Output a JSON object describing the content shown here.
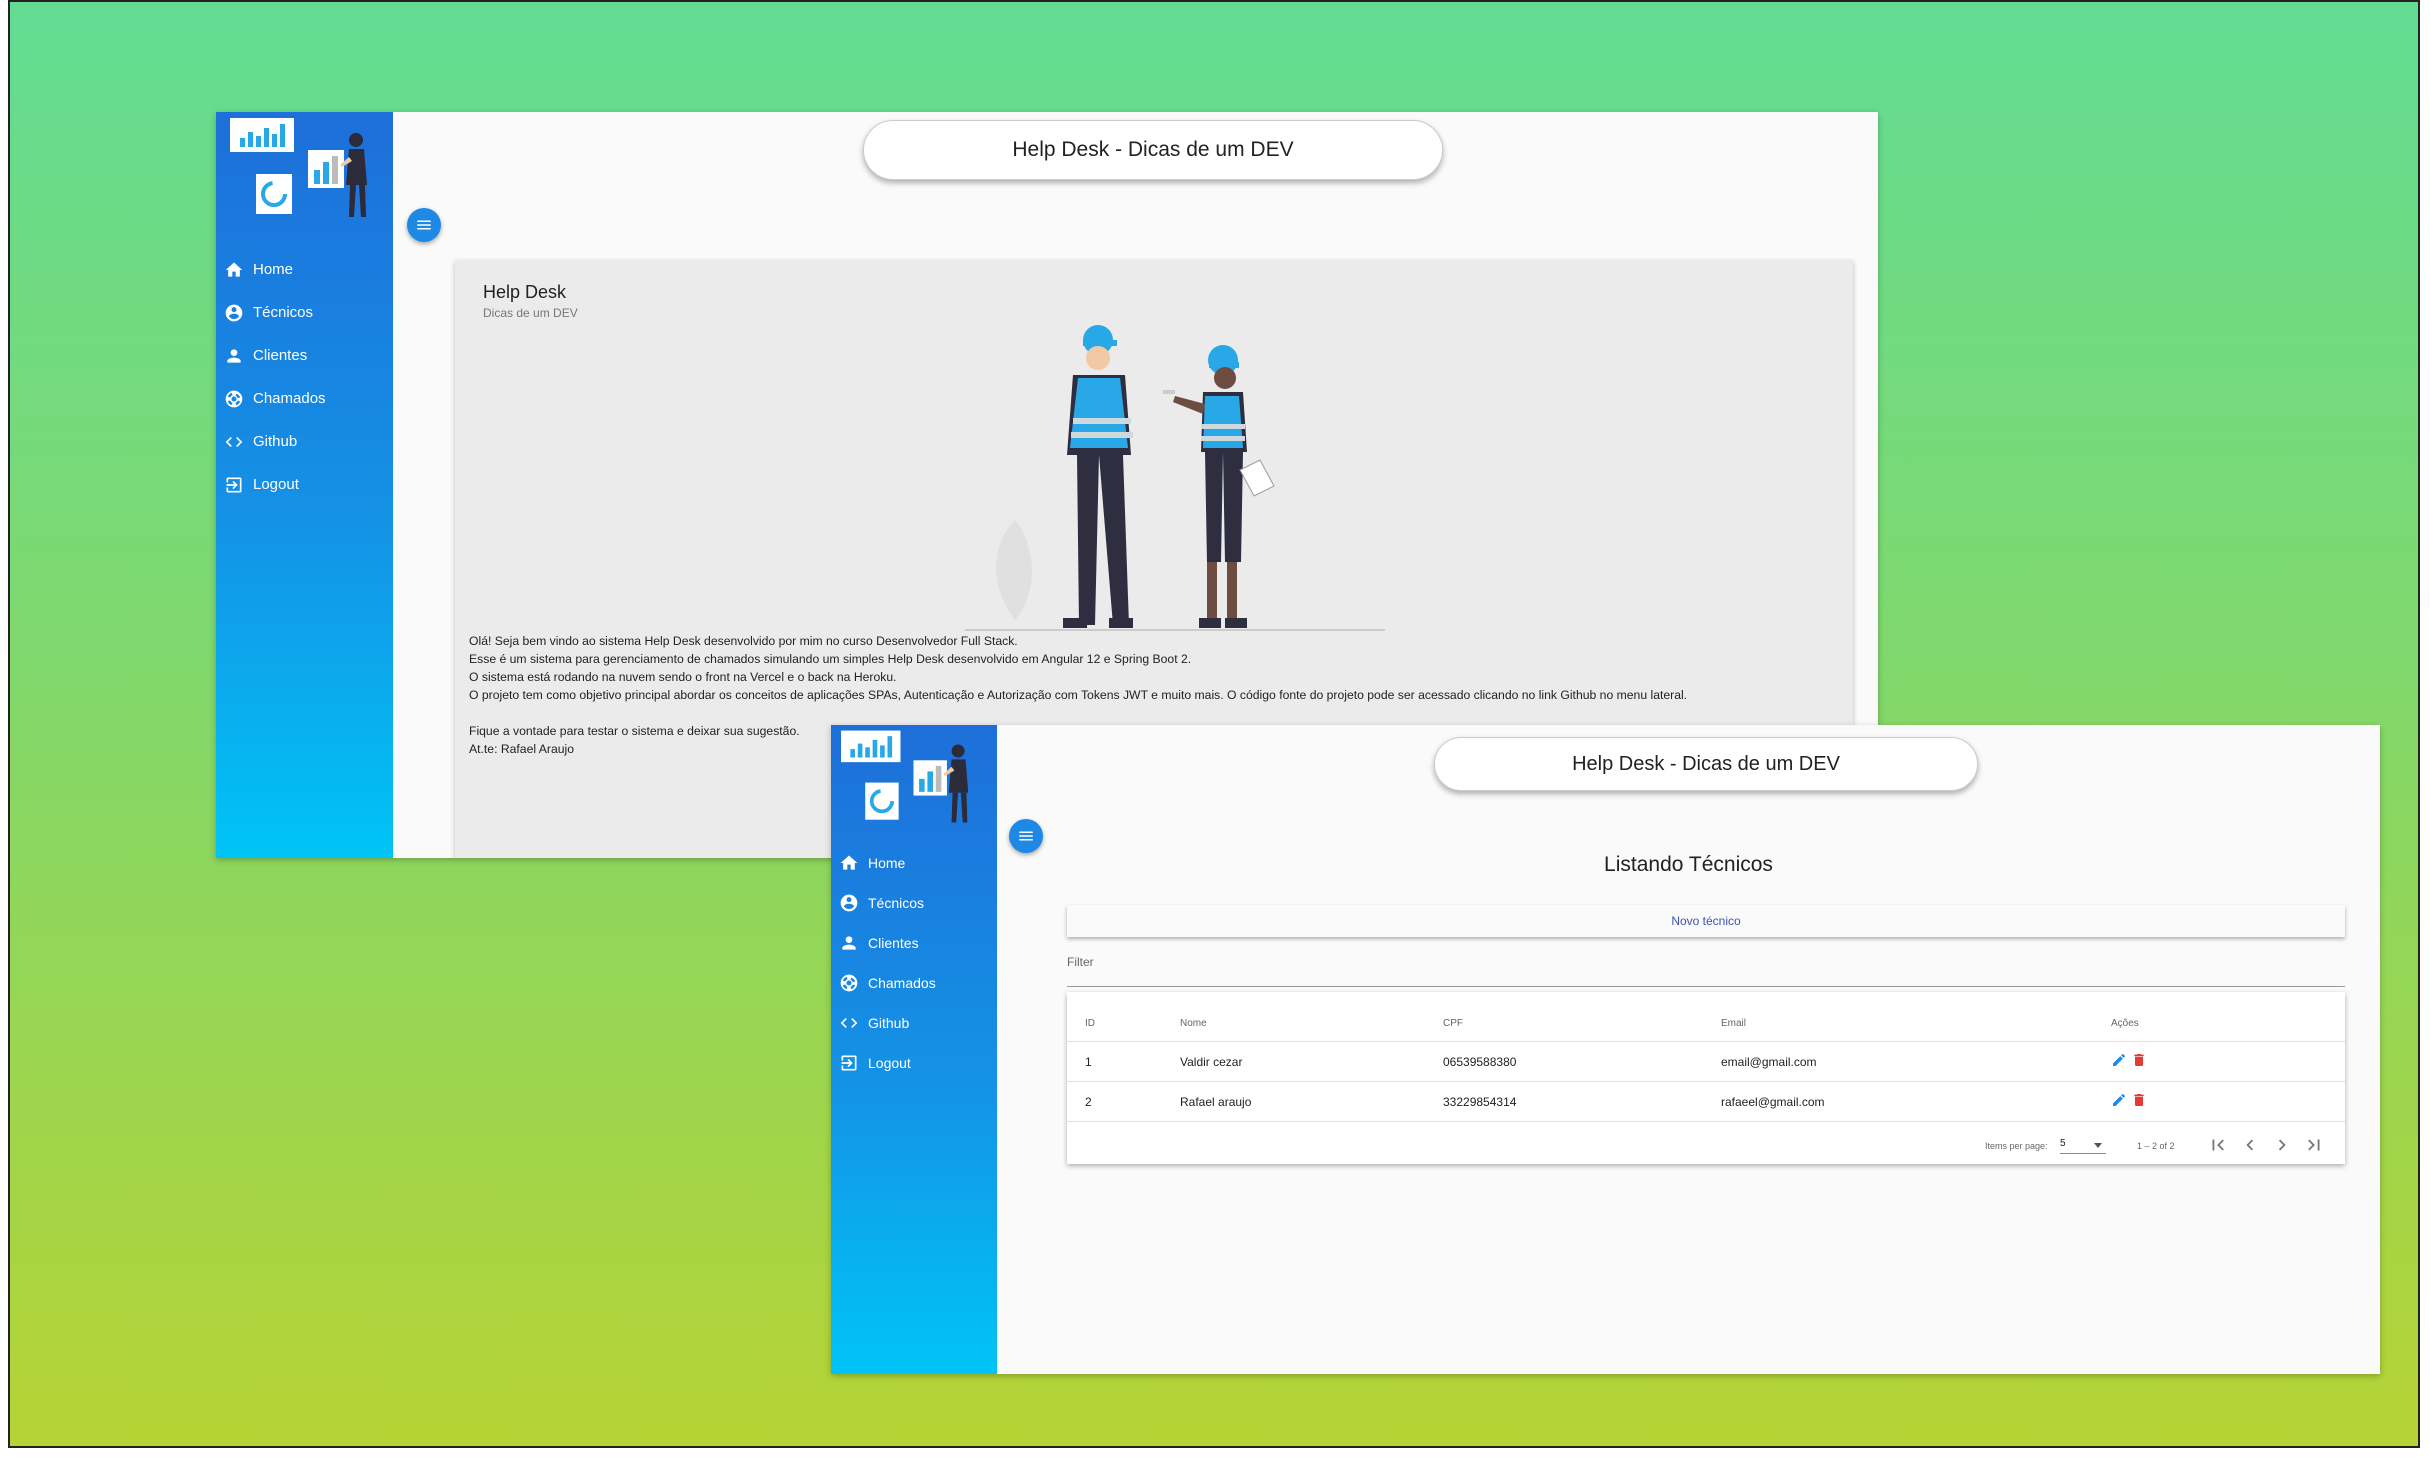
{
  "app_title": "Help Desk - Dicas de um DEV",
  "nav": [
    {
      "label": "Home",
      "icon": "home-icon"
    },
    {
      "label": "Técnicos",
      "icon": "account-circle-icon"
    },
    {
      "label": "Clientes",
      "icon": "person-icon"
    },
    {
      "label": "Chamados",
      "icon": "support-icon"
    },
    {
      "label": "Github",
      "icon": "code-icon"
    },
    {
      "label": "Logout",
      "icon": "logout-icon"
    }
  ],
  "home": {
    "card_title": "Help Desk",
    "card_subtitle": "Dicas de um DEV",
    "lines": [
      "Olá! Seja bem vindo ao sistema Help Desk desenvolvido por mim no curso Desenvolvedor Full Stack.",
      "Esse é um sistema para gerenciamento de chamados simulando um simples Help Desk desenvolvido em Angular 12 e Spring Boot 2.",
      "O sistema está rodando na nuvem sendo o front na Vercel e o back na Heroku.",
      "O projeto tem como objetivo principal abordar os conceitos de aplicações SPAs, Autenticação e Autorização com Tokens JWT e muito mais. O código fonte do projeto pode ser acessado clicando no link Github no menu lateral.",
      "",
      "Fique a vontade para testar o sistema e deixar sua sugestão.",
      "At.te: Rafael Araujo"
    ]
  },
  "tecnicos": {
    "page_title": "Listando Técnicos",
    "new_button": "Novo técnico",
    "filter_placeholder": "Filter",
    "columns": [
      "ID",
      "Nome",
      "CPF",
      "Email",
      "Ações"
    ],
    "rows": [
      {
        "id": "1",
        "nome": "Valdir cezar",
        "cpf": "06539588380",
        "email": "email@gmail.com"
      },
      {
        "id": "2",
        "nome": "Rafael araujo",
        "cpf": "33229854314",
        "email": "rafaeel@gmail.com"
      }
    ],
    "paginator": {
      "items_label": "Items per page:",
      "page_size": "5",
      "range": "1 – 2 of 2"
    }
  },
  "colors": {
    "sidebar_top": "#1e6fd9",
    "sidebar_bottom": "#00c4f5",
    "accent": "#1e88e5",
    "delete": "#e53935",
    "link": "#3f51b5"
  }
}
